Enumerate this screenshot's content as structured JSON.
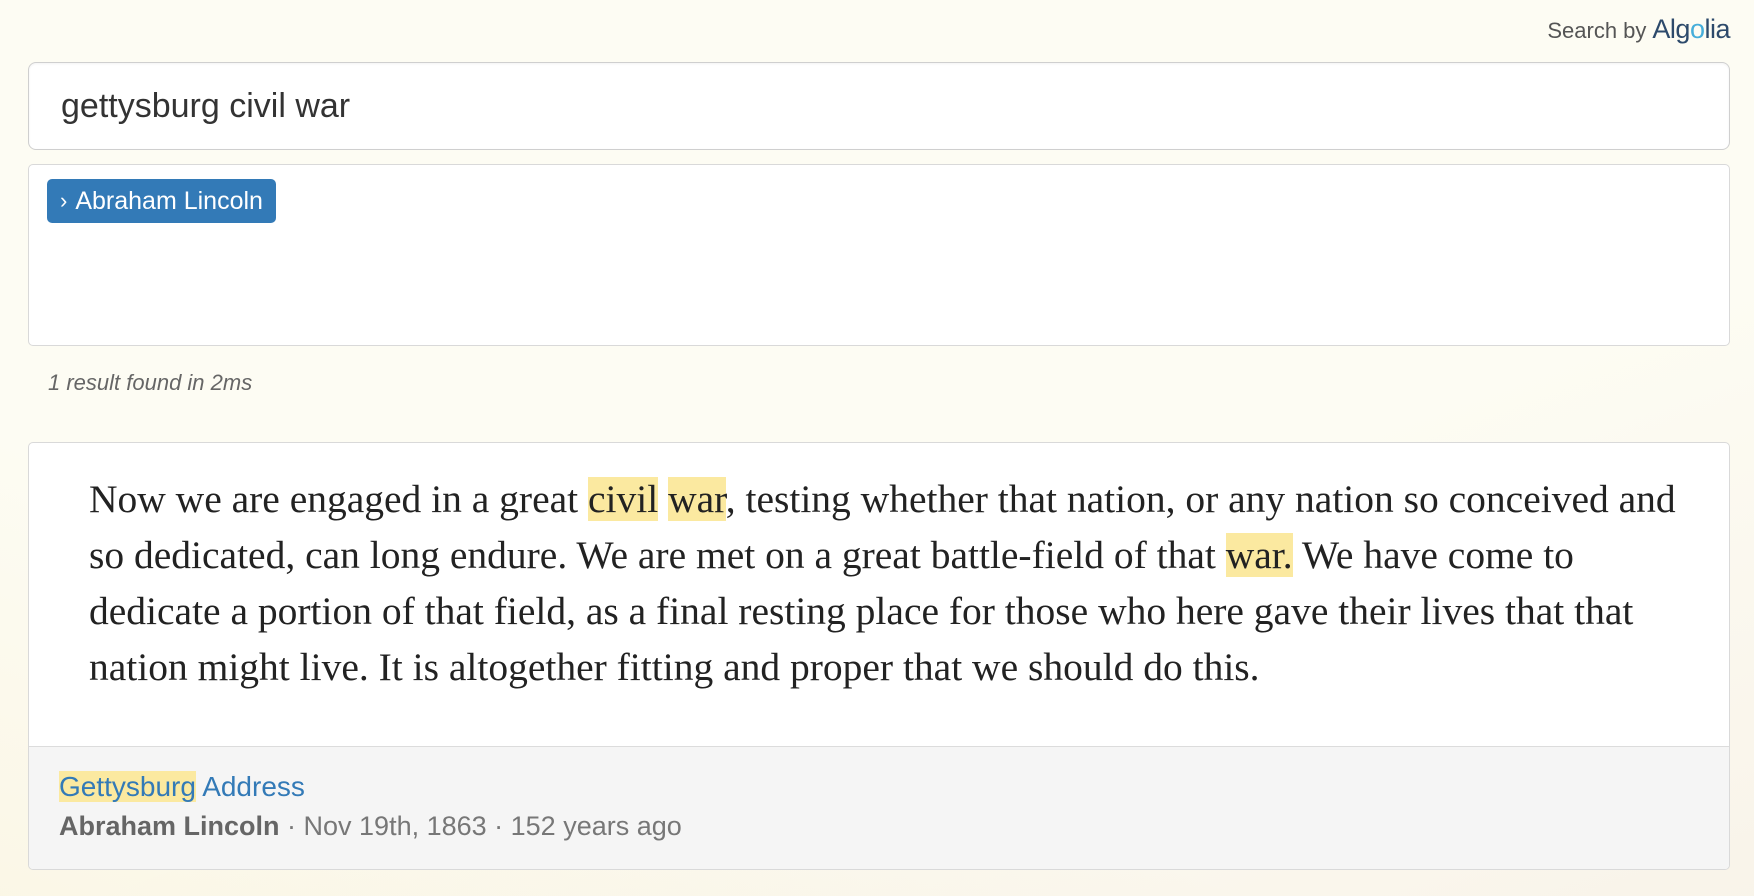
{
  "credit": {
    "prefix": "Search by",
    "brand_part1": "Alg",
    "brand_part2": "o",
    "brand_part3": "lia"
  },
  "search": {
    "query": "gettysburg civil war",
    "placeholder": ""
  },
  "facets": {
    "chevron": "›",
    "selected_label": "Abraham Lincoln"
  },
  "stats": {
    "text": "1 result found in 2ms"
  },
  "result": {
    "segments": [
      {
        "text": "Now we are engaged in a great ",
        "highlight": false
      },
      {
        "text": "civil",
        "highlight": true
      },
      {
        "text": " ",
        "highlight": false
      },
      {
        "text": "war",
        "highlight": true
      },
      {
        "text": ", testing whether that nation, or any nation so conceived and so dedicated, can long endure. We are met on a great battle-field of that ",
        "highlight": false
      },
      {
        "text": "war.",
        "highlight": true
      },
      {
        "text": " We have come to dedicate a portion of that field, as a final resting place for those who here gave their lives that that nation might live. It is altogether fitting and proper that we should do this.",
        "highlight": false
      }
    ],
    "title_highlight": "Gettysburg",
    "title_rest": " Address",
    "author": "Abraham Lincoln",
    "date": " · Nov 19th, 1863 · 152 years ago"
  },
  "colors": {
    "accent": "#337ab7",
    "highlight": "#fbe9a0",
    "algolia_blue": "#46aeda"
  }
}
